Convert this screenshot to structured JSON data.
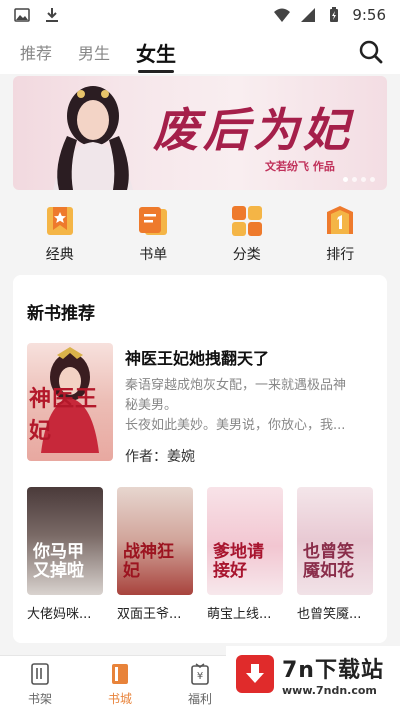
{
  "status_bar": {
    "time": "9:56"
  },
  "top_tabs": [
    {
      "label": "推荐",
      "active": false
    },
    {
      "label": "男生",
      "active": false
    },
    {
      "label": "女生",
      "active": true
    }
  ],
  "banner": {
    "title": "废后为妃",
    "subtitle": "文若纷飞 作品"
  },
  "quick_nav": [
    {
      "label": "经典",
      "icon": "star-bookmark-icon"
    },
    {
      "label": "书单",
      "icon": "booklist-icon"
    },
    {
      "label": "分类",
      "icon": "category-icon"
    },
    {
      "label": "排行",
      "icon": "ranking-icon"
    }
  ],
  "new_books": {
    "section_title": "新书推荐",
    "featured": {
      "title": "神医王妃她拽翻天了",
      "cover_text": "神医王妃",
      "description_lines": [
        "秦语穿越成炮灰女配，一来就遇极品神",
        "秘美男。",
        "长夜如此美妙。美男说，你放心，我..."
      ],
      "author": "作者：姜婉"
    },
    "books": [
      {
        "name": "大佬妈咪...",
        "cover_text": "你马甲又掉啦"
      },
      {
        "name": "双面王爷...",
        "cover_text": "战神狂妃"
      },
      {
        "name": "萌宝上线...",
        "cover_text": "爹地请接好"
      },
      {
        "name": "也曾笑魇...",
        "cover_text": "也曾笑魇如花"
      }
    ]
  },
  "bottom_nav": [
    {
      "label": "书架",
      "icon": "bookshelf-icon",
      "active": false
    },
    {
      "label": "书城",
      "icon": "bookstore-icon",
      "active": true
    },
    {
      "label": "福利",
      "icon": "welfare-icon",
      "active": false
    }
  ],
  "watermark": {
    "title": "7n下载站",
    "url": "www.7ndn.com"
  },
  "colors": {
    "accent": "#e8833a",
    "banner_title": "#a51f4a",
    "watermark_red": "#e02b2b"
  }
}
